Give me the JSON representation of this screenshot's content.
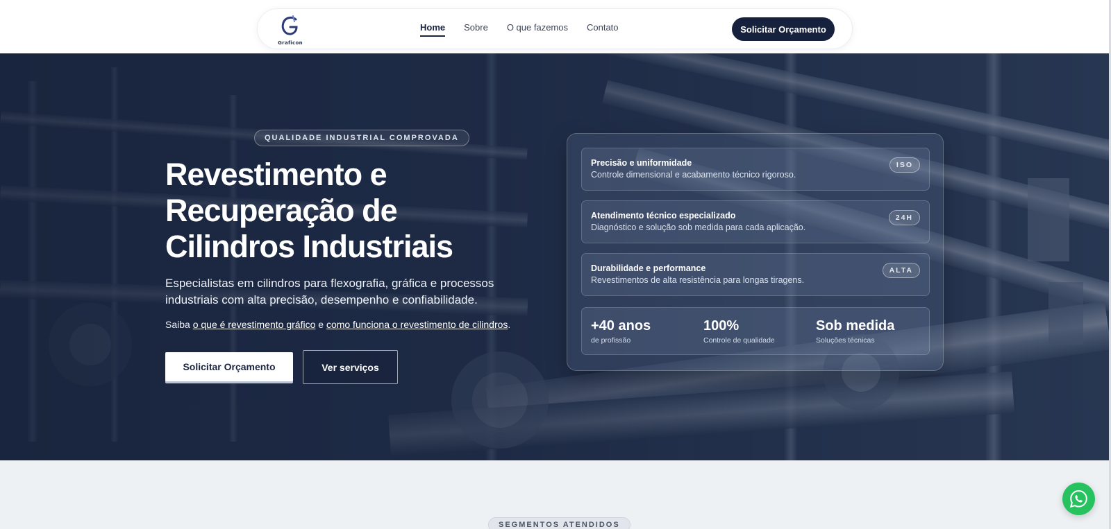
{
  "header": {
    "logo_text": "Graficon",
    "nav": [
      "Home",
      "Sobre",
      "O que fazemos",
      "Contato"
    ],
    "cta_label": "Solicitar Orçamento"
  },
  "hero": {
    "eyebrow": "QUALIDADE INDUSTRIAL COMPROVADA",
    "title": "Revestimento e Recuperação de Cilindros Industriais",
    "subtitle": "Especialistas em cilindros para flexografia, gráfica e processos industriais com alta precisão, desempenho e confiabilidade.",
    "links_prefix": "Saiba",
    "link1": "o que é revestimento gráfico",
    "links_middle": "e",
    "link2": "como funciona o revestimento de cilindros",
    "links_suffix": ".",
    "primary_button": "Solicitar Orçamento",
    "secondary_button": "Ver serviços"
  },
  "panel": {
    "features": [
      {
        "title": "Precisão e uniformidade",
        "description": "Controle dimensional e acabamento técnico rigoroso.",
        "badge": "ISO"
      },
      {
        "title": "Atendimento técnico especializado",
        "description": "Diagnóstico e solução sob medida para cada aplicação.",
        "badge": "24H"
      },
      {
        "title": "Durabilidade e performance",
        "description": "Revestimentos de alta resistência para longas tiragens.",
        "badge": "ALTA"
      }
    ],
    "stats": [
      {
        "value": "+40 anos",
        "label": "de profissão"
      },
      {
        "value": "100%",
        "label": "Controle de qualidade"
      },
      {
        "value": "Sob medida",
        "label": "Soluções técnicas"
      }
    ]
  },
  "lower": {
    "tag": "SEGMENTOS ATENDIDOS"
  },
  "colors": {
    "brand_navy": "#16213d",
    "hero_overlay": "#1c2a45",
    "whatsapp_green": "#27c25f",
    "section_bg": "#eef1f4"
  },
  "icons": {
    "logo": "graficon-g-logo",
    "floating": "whatsapp-icon"
  }
}
